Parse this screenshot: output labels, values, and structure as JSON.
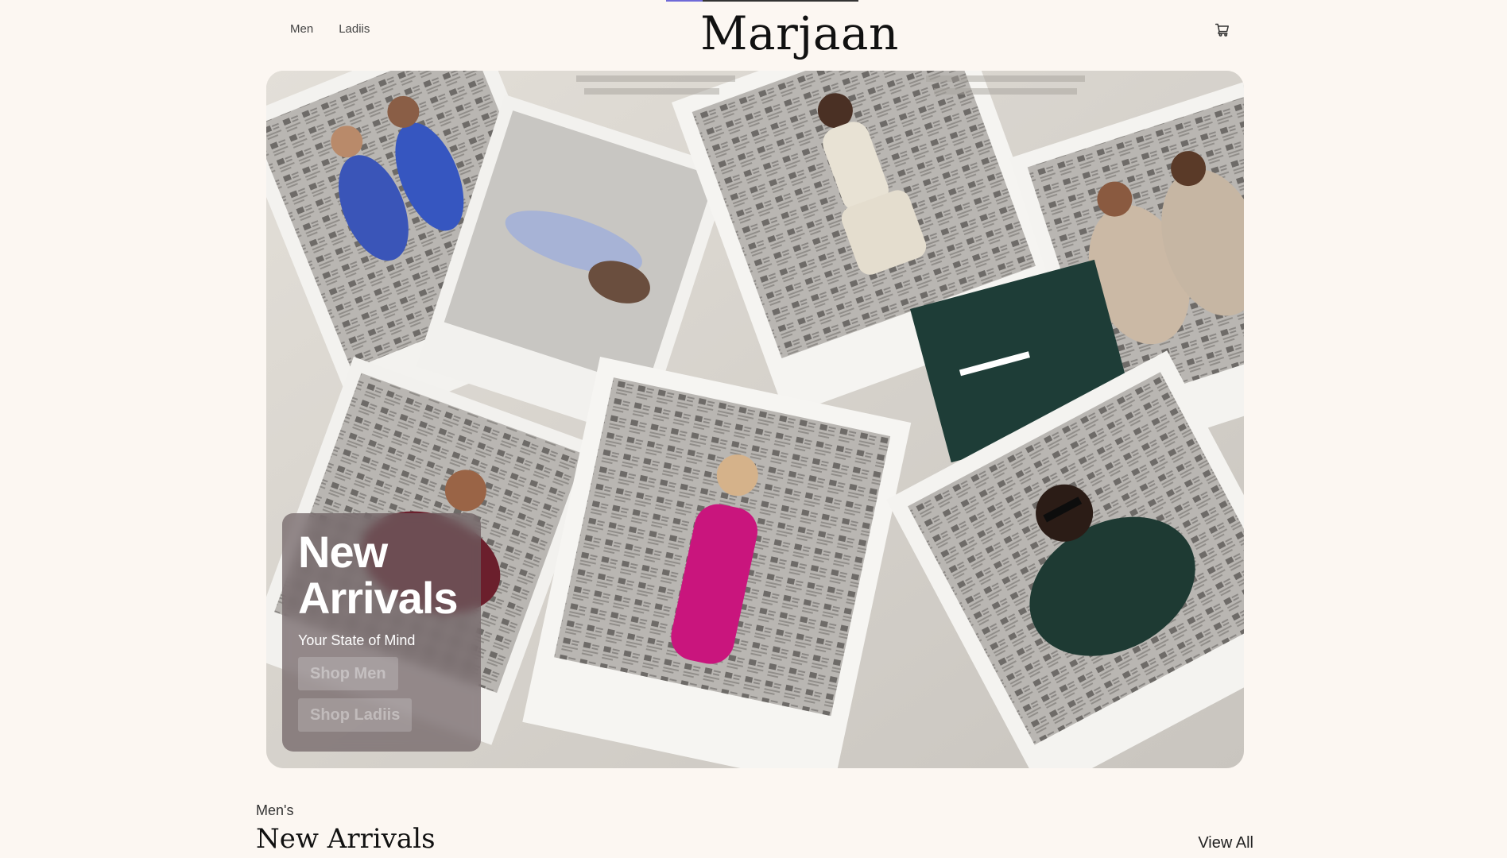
{
  "progress": {
    "fraction": 0.19
  },
  "header": {
    "nav": [
      {
        "label": "Men"
      },
      {
        "label": "Ladiis"
      }
    ],
    "brand": "Marjaan",
    "cart_icon": "cart-icon"
  },
  "hero": {
    "title_line1": "New",
    "title_line2": "Arrivals",
    "subtitle": "Your State of Mind",
    "buttons": [
      {
        "label": "Shop Men"
      },
      {
        "label": "Shop Ladiis"
      }
    ]
  },
  "section": {
    "eyebrow": "Men's",
    "title": "New Arrivals",
    "view_all": "View All"
  },
  "colors": {
    "background": "#fcf7f2",
    "accent": "#6f6ad8"
  }
}
